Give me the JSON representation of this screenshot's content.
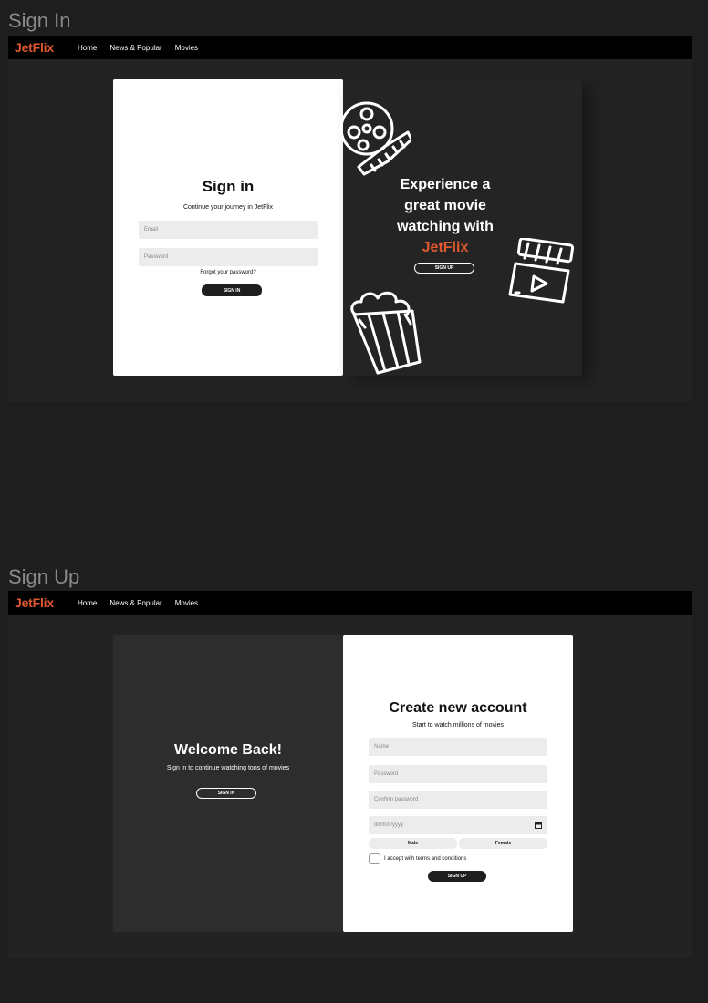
{
  "frames": {
    "signin_label": "Sign In",
    "signup_label": "Sign Up"
  },
  "nav": {
    "logo": "JetFlix",
    "links": [
      "Home",
      "News & Popular",
      "Movies"
    ]
  },
  "signin": {
    "title": "Sign in",
    "subtitle": "Continue your journey in JetFlix",
    "email_placeholder": "Email",
    "password_placeholder": "Password",
    "forgot": "Forgot your password?",
    "button": "SIGN IN",
    "promo_line1": "Experience a",
    "promo_line2": "great movie",
    "promo_line3": "watching with",
    "promo_brand": "JetFlix",
    "promo_button": "SIGN UP"
  },
  "signup": {
    "welcome_title": "Welcome Back!",
    "welcome_subtitle": "Sign in to continue watching tons of movies",
    "welcome_button": "SIGN IN",
    "title": "Create new account",
    "subtitle": "Start to watch millions of movies",
    "name_placeholder": "Name",
    "password_placeholder": "Password",
    "confirm_placeholder": "Confirm password",
    "date_placeholder": "dd/mm/yyyy",
    "gender_male": "Male",
    "gender_female": "Female",
    "terms": "I accept with terms and conditions",
    "button": "SIGN UP"
  },
  "colors": {
    "brand": "#e0582f",
    "background": "#1e1e1e",
    "panel_dark": "#242424"
  },
  "icons": [
    "film-reel-icon",
    "popcorn-icon",
    "clapperboard-icon",
    "calendar-icon"
  ]
}
